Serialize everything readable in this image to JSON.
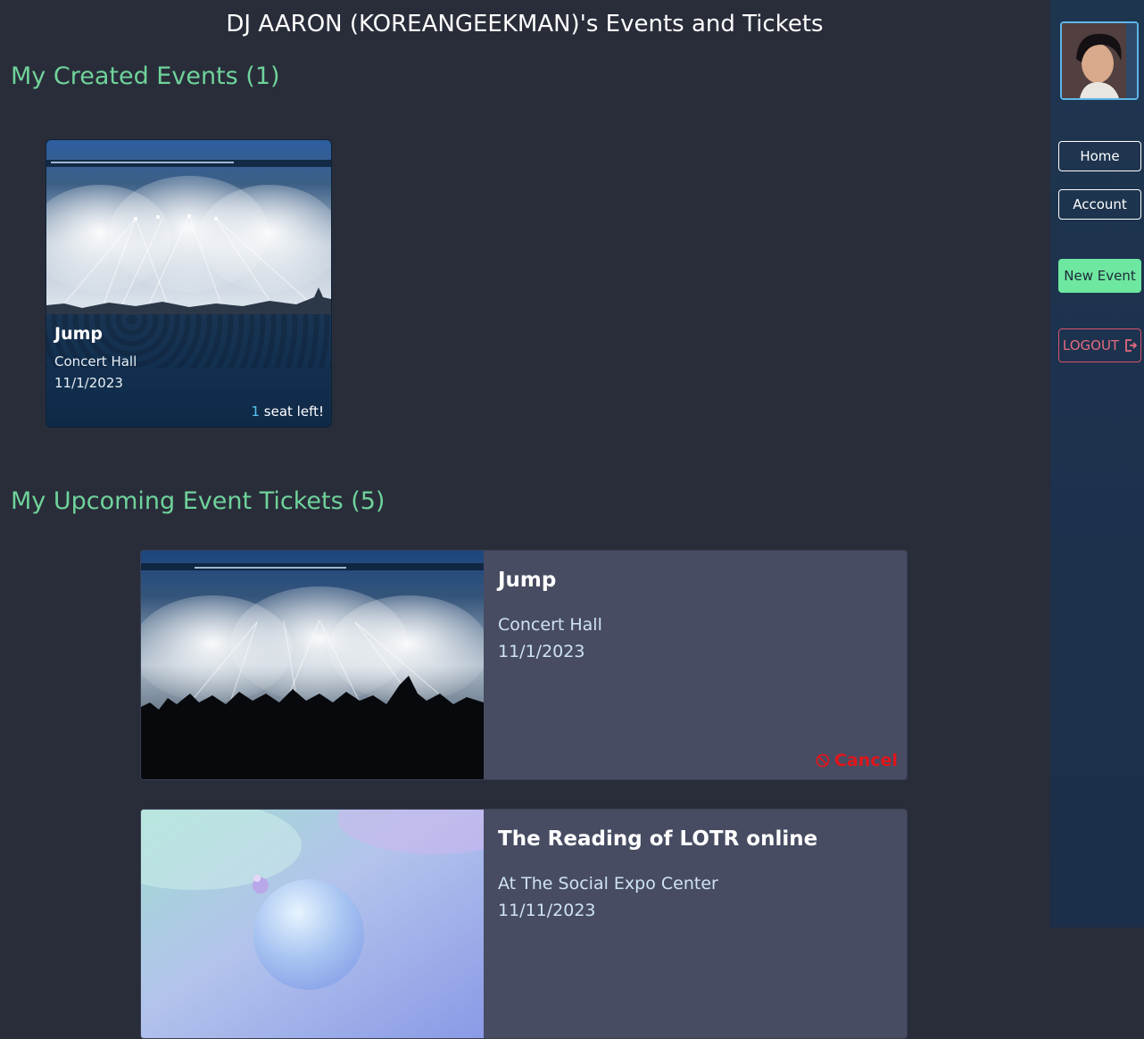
{
  "page": {
    "title": "DJ AARON (KOREANGEEKMAN)'s Events and Tickets"
  },
  "created_section": {
    "heading": "My Created Events (1)",
    "events": [
      {
        "title": "Jump",
        "venue": "Concert Hall",
        "date": "11/1/2023",
        "seats_left": "1",
        "seats_suffix": " seat left!"
      }
    ]
  },
  "tickets_section": {
    "heading": "My Upcoming Event Tickets (5)",
    "tickets": [
      {
        "title": "Jump",
        "venue": "Concert Hall",
        "date": "11/1/2023",
        "cancel_label": "Cancel"
      },
      {
        "title": "The Reading of LOTR online",
        "venue": "At The Social Expo Center",
        "date": "11/11/2023"
      }
    ]
  },
  "sidebar": {
    "home_label": "Home",
    "account_label": "Account",
    "new_event_label": "New Event",
    "logout_label": "LOGOUT"
  },
  "colors": {
    "background": "#292d3a",
    "heading_green": "#6fd39a",
    "new_event_bg": "#6ee7a0",
    "logout": "#e36b80",
    "cancel": "#e0161b",
    "ticket_bg": "#474c62"
  }
}
